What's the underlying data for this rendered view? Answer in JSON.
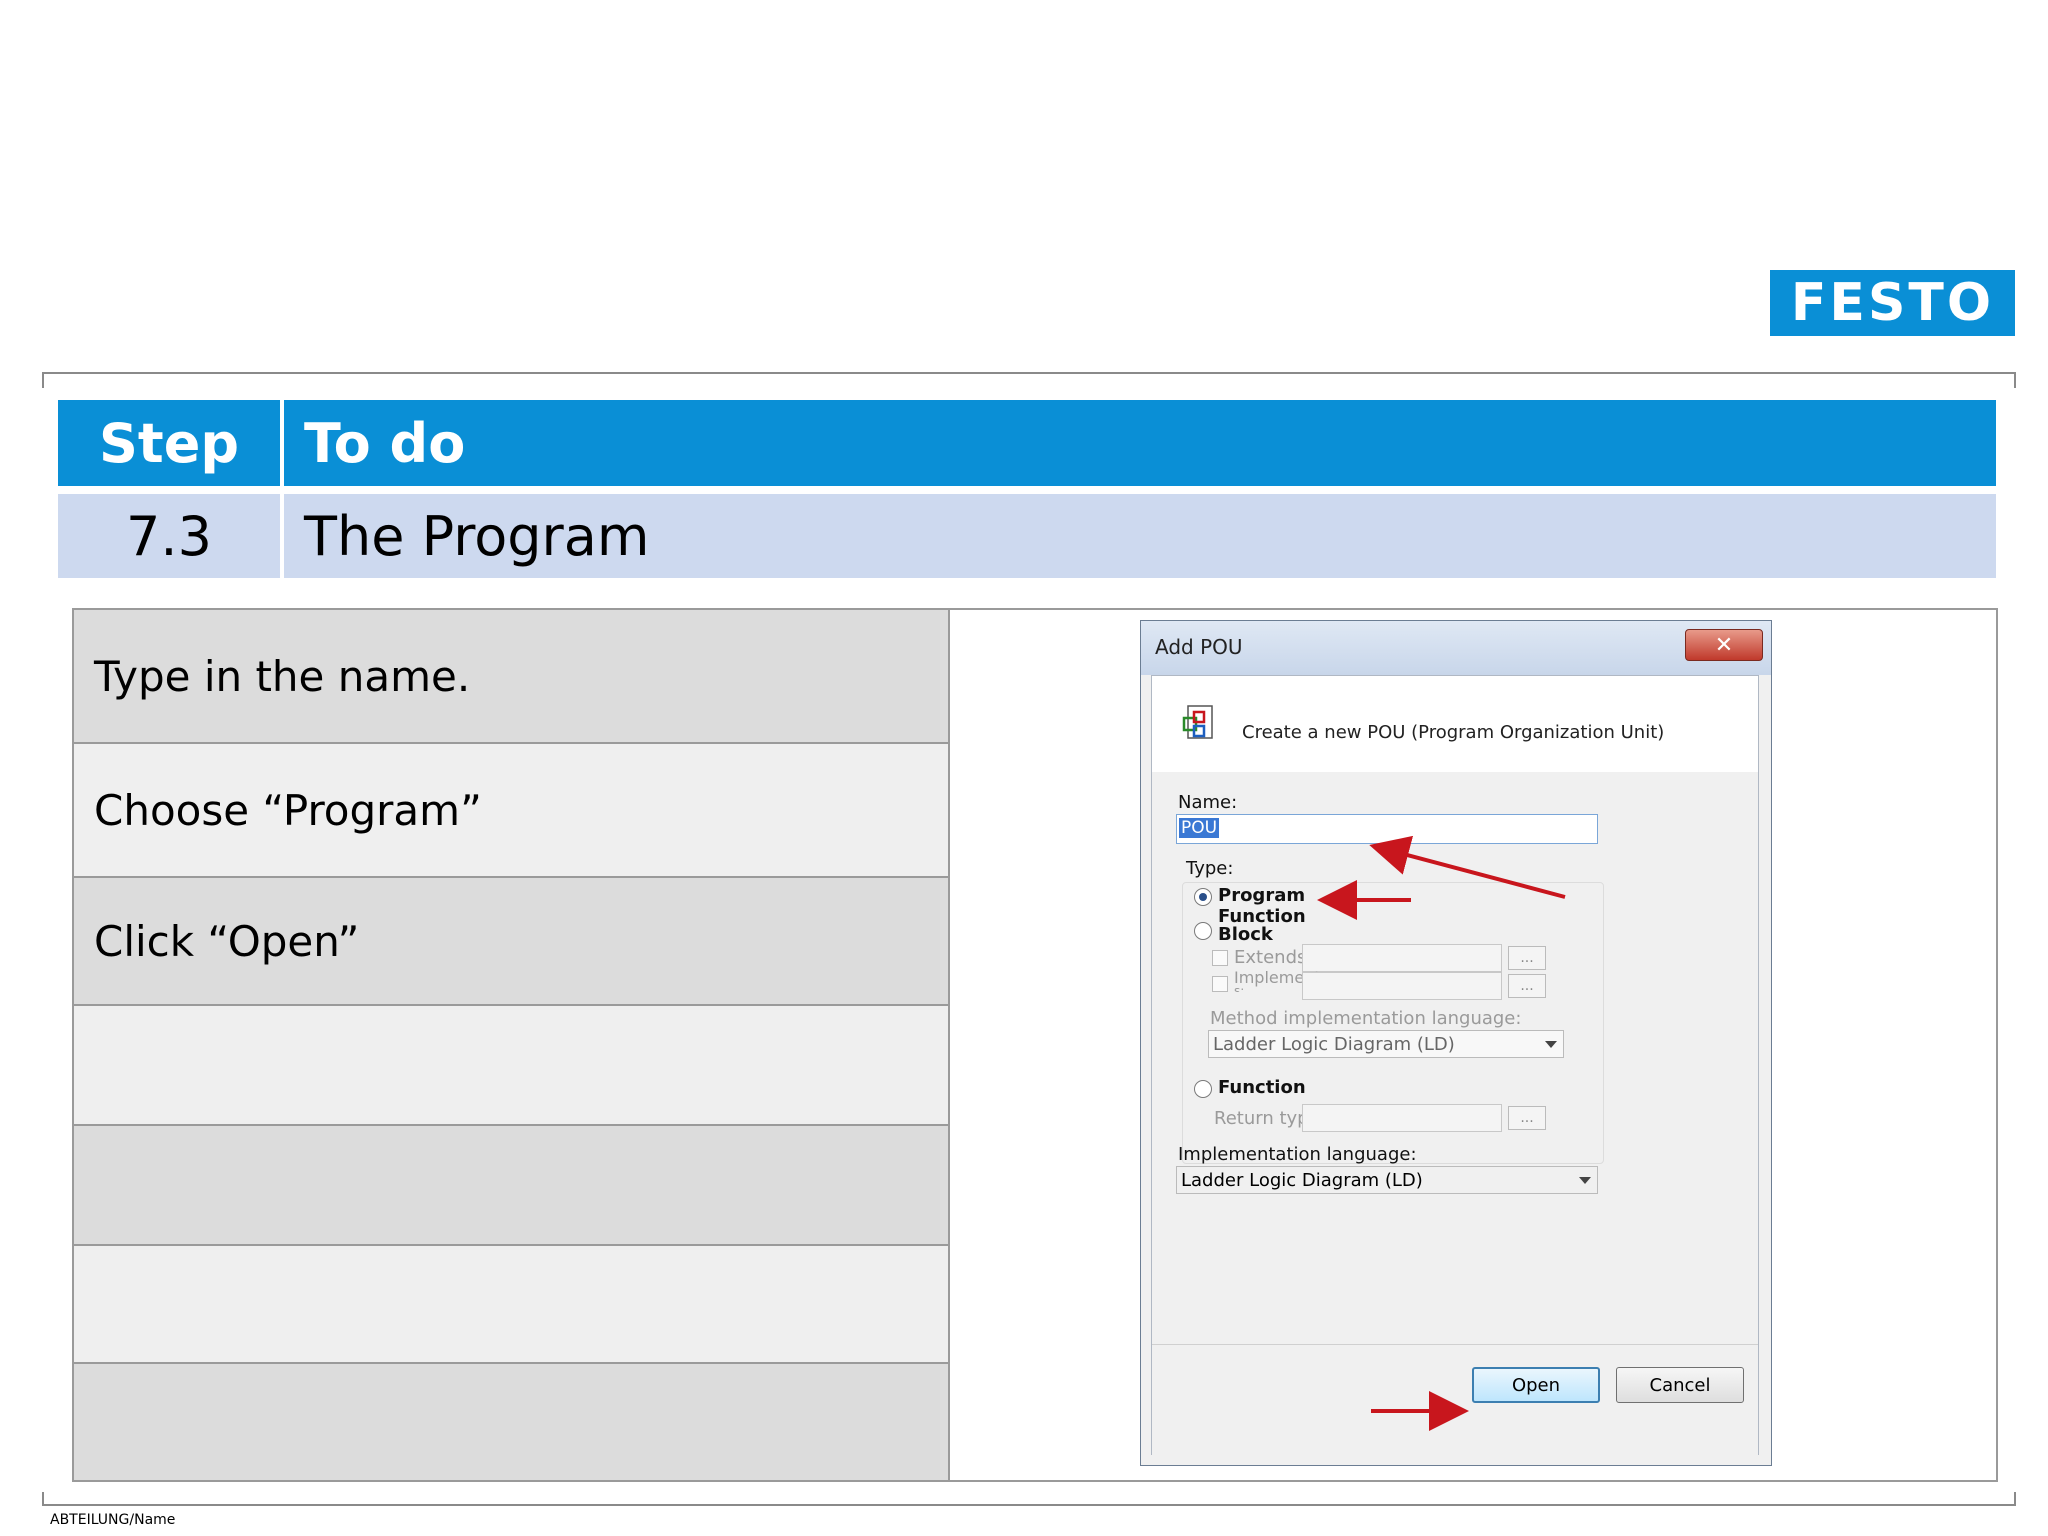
{
  "brand": {
    "logo_text": "FESTO",
    "color": "#0a8fd6"
  },
  "header": {
    "step_label": "Step",
    "todo_label": "To do",
    "bg_color": "#0a8fd6"
  },
  "subheader": {
    "step": "7.3",
    "title": "The Program",
    "bg_color": "#cdd9ef"
  },
  "steps": [
    {
      "text": "Type in the name."
    },
    {
      "text": "Choose “Program”"
    },
    {
      "text": "Click “Open”"
    },
    {
      "text": ""
    },
    {
      "text": ""
    },
    {
      "text": ""
    },
    {
      "text": ""
    }
  ],
  "dialog": {
    "title": "Add POU",
    "close_glyph": "✕",
    "banner_text": "Create a new POU (Program Organization Unit)",
    "banner_icon": "pou-icon",
    "name_label": "Name:",
    "name_value": "POU",
    "type_label": "Type:",
    "type_options": {
      "program": "Program",
      "function": "Function",
      "block": "Block",
      "function2": "Function"
    },
    "selected_type": "Program",
    "extends_label": "Extends:",
    "implements_label": "Implement",
    "implements_suffix": "s:",
    "ellipsis": "...",
    "method_lang_label": "Method implementation language:",
    "method_lang_value": "Ladder Logic Diagram (LD)",
    "return_type_label": "Return type:",
    "impl_lang_label": "Implementation language:",
    "impl_lang_value": "Ladder Logic Diagram (LD)",
    "open_label": "Open",
    "cancel_label": "Cancel",
    "arrow_color": "#c8161d"
  },
  "footer": {
    "department": "ABTEILUNG/Name"
  }
}
